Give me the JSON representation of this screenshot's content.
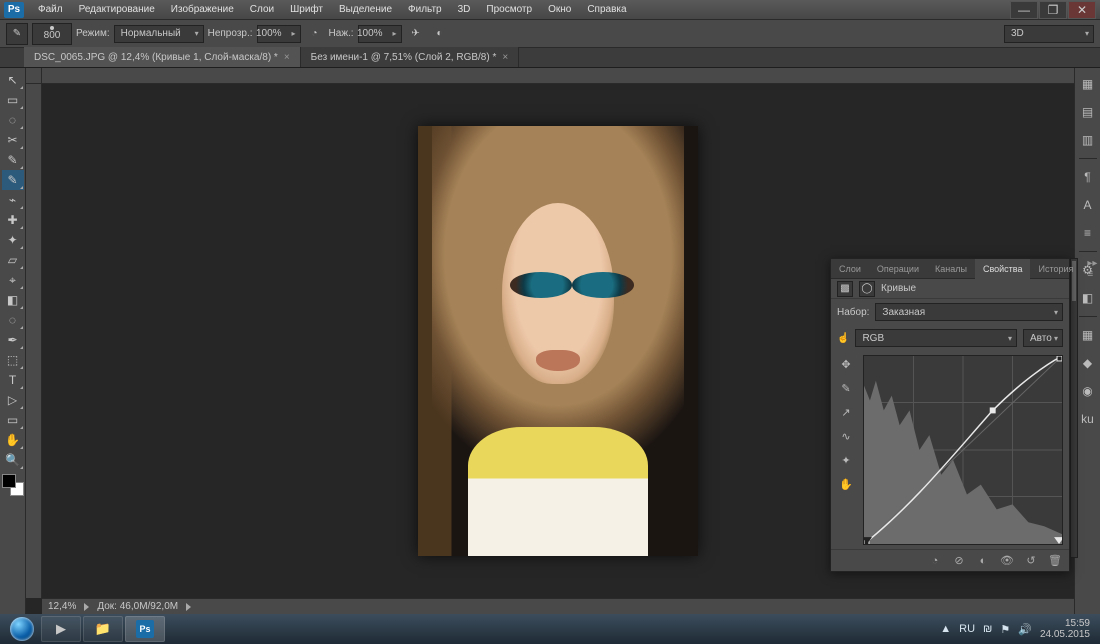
{
  "menu": [
    "Файл",
    "Редактирование",
    "Изображение",
    "Слои",
    "Шрифт",
    "Выделение",
    "Фильтр",
    "3D",
    "Просмотр",
    "Окно",
    "Справка"
  ],
  "options": {
    "brush_size": "800",
    "mode_label": "Режим:",
    "mode_value": "Нормальный",
    "opacity_label": "Непрозр.:",
    "opacity_value": "100%",
    "flow_label": "Наж.:",
    "flow_value": "100%",
    "workspace": "3D"
  },
  "tabs": [
    {
      "title": "DSC_0065.JPG @ 12,4% (Кривые 1, Слой-маска/8) *",
      "active": true
    },
    {
      "title": "Без имени-1 @ 7,51% (Слой 2, RGB/8) *",
      "active": false
    }
  ],
  "status": {
    "zoom": "12,4%",
    "doc": "Док: 46,0M/92,0M"
  },
  "panel": {
    "tabs": [
      "Слои",
      "Операции",
      "Каналы",
      "Свойства",
      "История"
    ],
    "active_tab": "Свойства",
    "adjust_name": "Кривые",
    "preset_label": "Набор:",
    "preset_value": "Заказная",
    "channel_value": "RGB",
    "auto_label": "Авто"
  },
  "tray": {
    "lang": "RU",
    "time": "15:59",
    "date": "24.05.2015"
  },
  "tools": [
    "↖",
    "▭",
    "◌",
    "✂",
    "✎",
    "✎",
    "⌁",
    "✚",
    "✦",
    "▱",
    "⌖",
    "◧",
    "◌",
    "✒",
    "⬚",
    "T",
    "▷",
    "▭",
    "✋",
    "🔍"
  ],
  "rdock": [
    "▦",
    "▤",
    "▥",
    "¶",
    "A",
    "≡",
    "⚙",
    "◧",
    "▦",
    "◆",
    "◉",
    "ku"
  ],
  "curve_tools": [
    "✥",
    "✎",
    "↗",
    "∿",
    "✦",
    "✋"
  ],
  "panel_foot": [
    "◔",
    "⊘",
    "◐",
    "👁",
    "↺",
    "🗑"
  ]
}
